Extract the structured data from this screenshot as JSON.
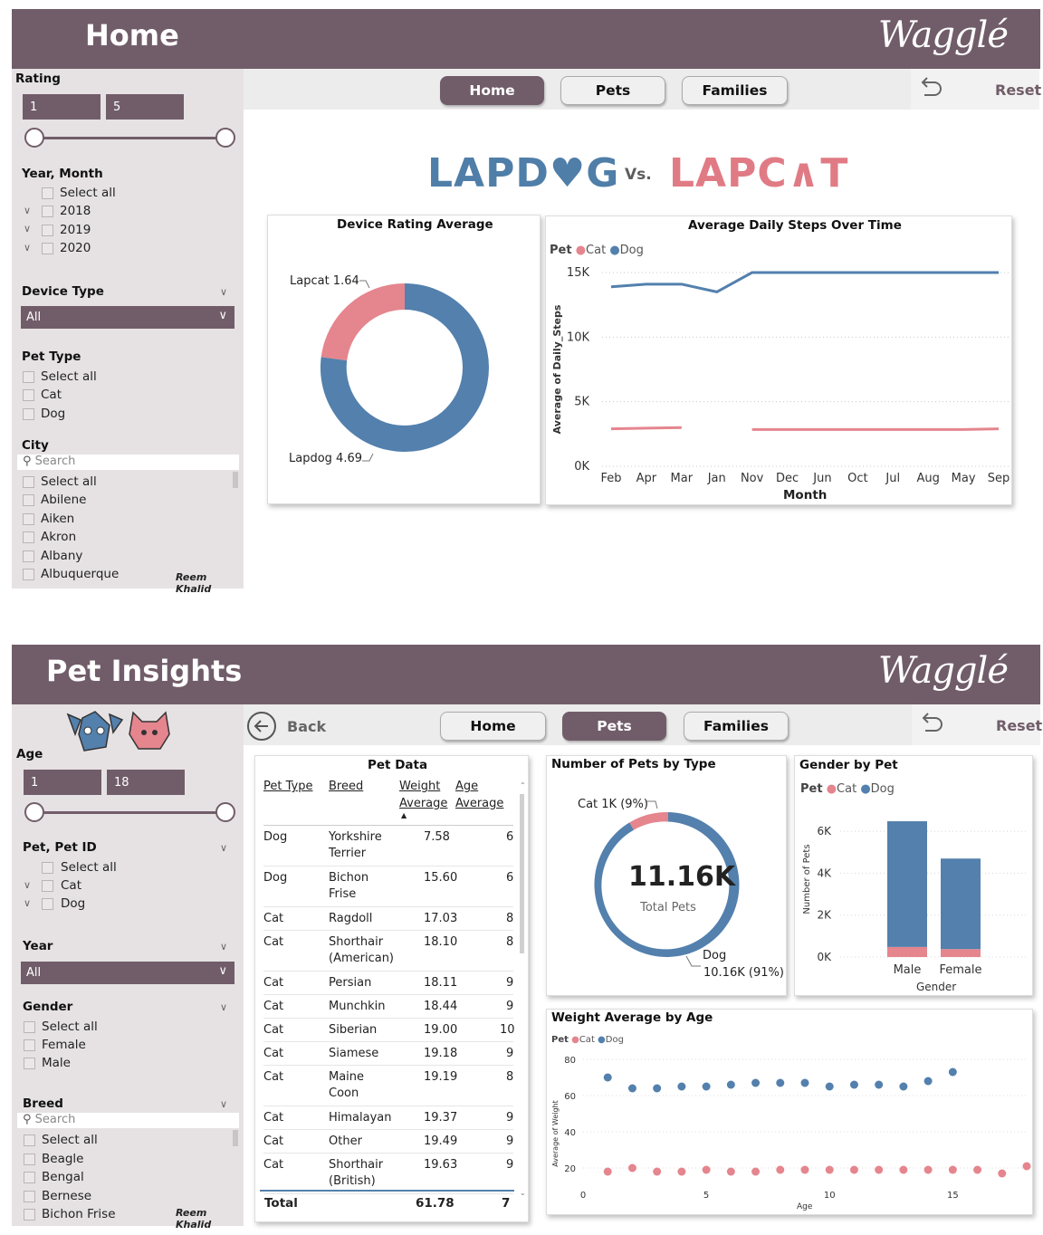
{
  "home": {
    "title": "Home",
    "logo": "Wagglé",
    "filters": {
      "rating": {
        "label": "Rating",
        "min": "1",
        "max": "5"
      },
      "year_month": {
        "label": "Year, Month",
        "select_all": "Select all",
        "items": [
          "2018",
          "2019",
          "2020"
        ]
      },
      "device_type": {
        "label": "Device Type",
        "value": "All"
      },
      "pet_type": {
        "label": "Pet Type",
        "select_all": "Select all",
        "items": [
          "Cat",
          "Dog"
        ]
      },
      "city": {
        "label": "City",
        "search_placeholder": "Search",
        "select_all": "Select all",
        "items": [
          "Abilene",
          "Aiken",
          "Akron",
          "Albany",
          "Albuquerque"
        ]
      }
    },
    "author": "Reem Khalid",
    "nav": {
      "home": "Home",
      "pets": "Pets",
      "families": "Families",
      "reset": "Reset"
    },
    "banner": {
      "left": "LAPD♥G",
      "vs": "Vs.",
      "right": "LAPC∧T"
    },
    "device_rating": {
      "title": "Device Rating Average",
      "lapcat_label": "Lapcat 1.64",
      "lapdog_label": "Lapdog 4.69"
    },
    "steps": {
      "title": "Average Daily Steps Over Time",
      "legend_title": "Pet",
      "cat": "Cat",
      "dog": "Dog",
      "xlabel": "Month",
      "ylabel": "Average of Daily_Steps"
    }
  },
  "insights": {
    "title": "Pet Insights",
    "logo": "Wagglé",
    "filters": {
      "age": {
        "label": "Age",
        "min": "1",
        "max": "18"
      },
      "pet_id": {
        "label": "Pet, Pet ID",
        "select_all": "Select all",
        "items": [
          "Cat",
          "Dog"
        ]
      },
      "year": {
        "label": "Year",
        "value": "All"
      },
      "gender": {
        "label": "Gender",
        "select_all": "Select all",
        "items": [
          "Female",
          "Male"
        ]
      },
      "breed": {
        "label": "Breed",
        "search_placeholder": "Search",
        "select_all": "Select all",
        "items": [
          "Beagle",
          "Bengal",
          "Bernese",
          "Bichon Frise"
        ]
      }
    },
    "author": "Reem Khalid",
    "nav": {
      "back": "Back",
      "home": "Home",
      "pets": "Pets",
      "families": "Families",
      "reset": "Reset"
    },
    "pet_data": {
      "title": "Pet Data",
      "headers": {
        "type": "Pet Type",
        "breed": "Breed",
        "weight_1": "Weight",
        "weight_2": "Average",
        "age_1": "Age",
        "age_2": "Average"
      },
      "rows": [
        {
          "type": "Dog",
          "breed": "Yorkshire",
          "breed2": "Terrier",
          "weight": "7.58",
          "age": "6"
        },
        {
          "type": "Dog",
          "breed": "Bichon",
          "breed2": "Frise",
          "weight": "15.60",
          "age": "6"
        },
        {
          "type": "Cat",
          "breed": "Ragdoll",
          "breed2": "",
          "weight": "17.03",
          "age": "8"
        },
        {
          "type": "Cat",
          "breed": "Shorthair",
          "breed2": "(American)",
          "weight": "18.10",
          "age": "8"
        },
        {
          "type": "Cat",
          "breed": "Persian",
          "breed2": "",
          "weight": "18.11",
          "age": "9"
        },
        {
          "type": "Cat",
          "breed": "Munchkin",
          "breed2": "",
          "weight": "18.44",
          "age": "9"
        },
        {
          "type": "Cat",
          "breed": "Siberian",
          "breed2": "",
          "weight": "19.00",
          "age": "10"
        },
        {
          "type": "Cat",
          "breed": "Siamese",
          "breed2": "",
          "weight": "19.18",
          "age": "9"
        },
        {
          "type": "Cat",
          "breed": "Maine",
          "breed2": "Coon",
          "weight": "19.19",
          "age": "8"
        },
        {
          "type": "Cat",
          "breed": "Himalayan",
          "breed2": "",
          "weight": "19.37",
          "age": "9"
        },
        {
          "type": "Cat",
          "breed": "Other",
          "breed2": "",
          "weight": "19.49",
          "age": "9"
        },
        {
          "type": "Cat",
          "breed": "Shorthair",
          "breed2": "(British)",
          "weight": "19.63",
          "age": "9"
        }
      ],
      "total_label": "Total",
      "total_weight": "61.78",
      "total_age": "7"
    },
    "pets_by_type": {
      "title": "Number of Pets by Type",
      "cat_label": "Cat 1K (9%)",
      "dog_label_1": "Dog",
      "dog_label_2": "10.16K (91%)",
      "center_value": "11.16K",
      "center_label": "Total Pets"
    },
    "gender_by_pet": {
      "title": "Gender by Pet",
      "legend_title": "Pet",
      "cat": "Cat",
      "dog": "Dog",
      "xlabel": "Gender",
      "ylabel": "Number of Pets"
    },
    "weight_by_age": {
      "title": "Weight Average by Age",
      "legend_title": "Pet",
      "cat": "Cat",
      "dog": "Dog",
      "xlabel": "Age",
      "ylabel": "Average of Weight"
    }
  },
  "colors": {
    "brand": "#715d69",
    "cat": "#e5858e",
    "dog": "#5380ad",
    "lapdog_text": "#4f7ea8",
    "lapcat_text": "#e07b85"
  },
  "chart_data": [
    {
      "type": "pie",
      "title": "Device Rating Average",
      "categories": [
        "Lapcat",
        "Lapdog"
      ],
      "values": [
        1.64,
        4.69
      ]
    },
    {
      "type": "line",
      "title": "Average Daily Steps Over Time",
      "xlabel": "Month",
      "ylabel": "Average of Daily_Steps",
      "categories": [
        "Feb",
        "Apr",
        "Mar",
        "Jan",
        "Nov",
        "Dec",
        "Jun",
        "Oct",
        "Jul",
        "Aug",
        "May",
        "Sep"
      ],
      "ylim": [
        0,
        15000
      ],
      "yticks": [
        "0K",
        "5K",
        "10K",
        "15K"
      ],
      "legend": "top-left",
      "series": [
        {
          "name": "Cat",
          "values": [
            2900,
            2950,
            3000,
            null,
            2850,
            2850,
            2850,
            2850,
            2850,
            2850,
            2850,
            2900
          ]
        },
        {
          "name": "Dog",
          "values": [
            13900,
            14100,
            14100,
            13500,
            15000,
            15000,
            15000,
            15000,
            15000,
            15000,
            15000,
            15000
          ]
        }
      ]
    },
    {
      "type": "pie",
      "title": "Number of Pets by Type",
      "categories": [
        "Cat",
        "Dog"
      ],
      "values": [
        1000,
        10160
      ]
    },
    {
      "type": "bar",
      "title": "Gender by Pet",
      "xlabel": "Gender",
      "ylabel": "Number of Pets",
      "categories": [
        "Male",
        "Female"
      ],
      "ylim": [
        0,
        7000
      ],
      "yticks": [
        "0K",
        "2K",
        "4K",
        "6K"
      ],
      "series": [
        {
          "name": "Cat",
          "values": [
            480,
            380
          ]
        },
        {
          "name": "Dog",
          "values": [
            6000,
            4320
          ]
        }
      ]
    },
    {
      "type": "scatter",
      "title": "Weight Average by Age",
      "xlabel": "Age",
      "ylabel": "Average of Weight",
      "xlim": [
        0,
        18
      ],
      "ylim": [
        10,
        80
      ],
      "xticks": [
        0,
        5,
        10,
        15
      ],
      "yticks": [
        20,
        40,
        60,
        80
      ],
      "series": [
        {
          "name": "Cat",
          "x": [
            1,
            2,
            3,
            4,
            5,
            6,
            7,
            8,
            9,
            10,
            11,
            12,
            13,
            14,
            15,
            16,
            17,
            18
          ],
          "y": [
            18,
            20,
            18,
            18,
            19,
            18,
            18,
            19,
            19,
            19,
            19,
            19,
            19,
            19,
            19,
            19,
            17,
            21
          ]
        },
        {
          "name": "Dog",
          "x": [
            1,
            2,
            3,
            4,
            5,
            6,
            7,
            8,
            9,
            10,
            11,
            12,
            13,
            14,
            15
          ],
          "y": [
            70,
            64,
            64,
            65,
            65,
            66,
            67,
            67,
            67,
            65,
            66,
            66,
            65,
            68,
            73
          ]
        }
      ]
    }
  ]
}
